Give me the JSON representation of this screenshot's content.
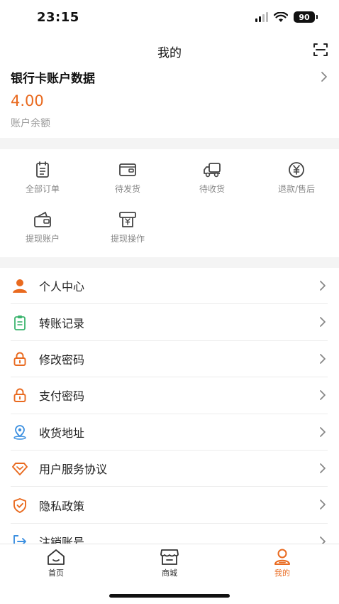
{
  "status_bar": {
    "time": "23:15",
    "battery": "90"
  },
  "nav": {
    "title": "我的",
    "scan_icon": "scan-icon"
  },
  "account": {
    "title": "银行卡账户数据",
    "amount": "4.00",
    "amount_label": "账户余额"
  },
  "orders": [
    {
      "label": "全部订单",
      "icon": "clipboard-list-icon"
    },
    {
      "label": "待发货",
      "icon": "wallet-icon"
    },
    {
      "label": "待收货",
      "icon": "truck-icon"
    },
    {
      "label": "退款/售后",
      "icon": "yen-circle-icon"
    },
    {
      "label": "提现账户",
      "icon": "wallet-card-icon"
    },
    {
      "label": "提现操作",
      "icon": "atm-yen-icon"
    }
  ],
  "menu": [
    {
      "label": "个人中心",
      "icon": "user-icon"
    },
    {
      "label": "转账记录",
      "icon": "clipboard-icon"
    },
    {
      "label": "修改密码",
      "icon": "lock-icon"
    },
    {
      "label": "支付密码",
      "icon": "lock-icon"
    },
    {
      "label": "收货地址",
      "icon": "location-icon"
    },
    {
      "label": "用户服务协议",
      "icon": "diamond-icon"
    },
    {
      "label": "隐私政策",
      "icon": "shield-icon"
    },
    {
      "label": "注销账号",
      "icon": "logout-icon"
    }
  ],
  "tabs": [
    {
      "label": "首页",
      "icon": "home-icon"
    },
    {
      "label": "商城",
      "icon": "shop-icon"
    },
    {
      "label": "我的",
      "icon": "profile-icon"
    }
  ],
  "colors": {
    "accent": "#e96a1f",
    "green": "#3bb46e",
    "blue": "#3b8fe0",
    "divider": "#f4f4f4"
  }
}
